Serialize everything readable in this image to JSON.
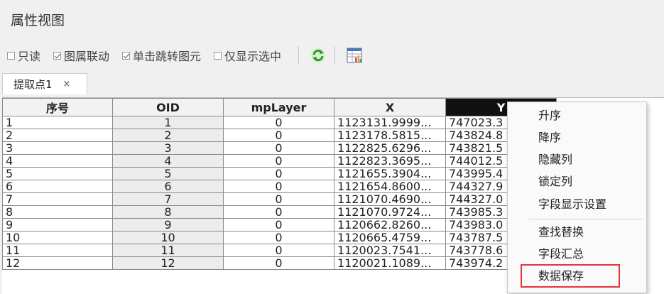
{
  "window": {
    "title": "属性视图"
  },
  "toolbar": {
    "checkboxes": [
      {
        "label": "只读",
        "checked": false
      },
      {
        "label": "图属联动",
        "checked": true
      },
      {
        "label": "单击跳转图元",
        "checked": true
      },
      {
        "label": "仅显示选中",
        "checked": false
      }
    ],
    "buttons": [
      {
        "icon": "refresh-icon"
      },
      {
        "icon": "table-chart-icon"
      }
    ]
  },
  "tabs": [
    {
      "label": "提取点1",
      "close": "×"
    }
  ],
  "table": {
    "columns": [
      "序号",
      "OID",
      "mpLayer",
      "X",
      "Y"
    ],
    "rows": [
      [
        "1",
        "1",
        "0",
        "1123131.9999...",
        "747023.3"
      ],
      [
        "2",
        "2",
        "0",
        "1123178.5815...",
        "743824.8"
      ],
      [
        "3",
        "3",
        "0",
        "1122825.6296...",
        "743821.5"
      ],
      [
        "4",
        "4",
        "0",
        "1122823.3695...",
        "744012.5"
      ],
      [
        "5",
        "5",
        "0",
        "1121655.3904...",
        "743995.4"
      ],
      [
        "6",
        "6",
        "0",
        "1121654.8600...",
        "744327.9"
      ],
      [
        "7",
        "7",
        "0",
        "1121070.4690...",
        "744327.0"
      ],
      [
        "8",
        "8",
        "0",
        "1121070.9724...",
        "743985.3"
      ],
      [
        "9",
        "9",
        "0",
        "1120662.8260...",
        "743983.0"
      ],
      [
        "10",
        "10",
        "0",
        "1120665.4759...",
        "743787.5"
      ],
      [
        "11",
        "11",
        "0",
        "1120023.7541...",
        "743778.6"
      ],
      [
        "12",
        "12",
        "0",
        "1120021.1089...",
        "743974.2"
      ]
    ]
  },
  "context_menu": {
    "group1": [
      "升序",
      "降序",
      "隐藏列",
      "锁定列",
      "字段显示设置"
    ],
    "group2": [
      "查找替换",
      "字段汇总",
      "数据保存"
    ]
  },
  "colors": {
    "highlight_border": "#e0353a",
    "selected_header": "#111111"
  }
}
